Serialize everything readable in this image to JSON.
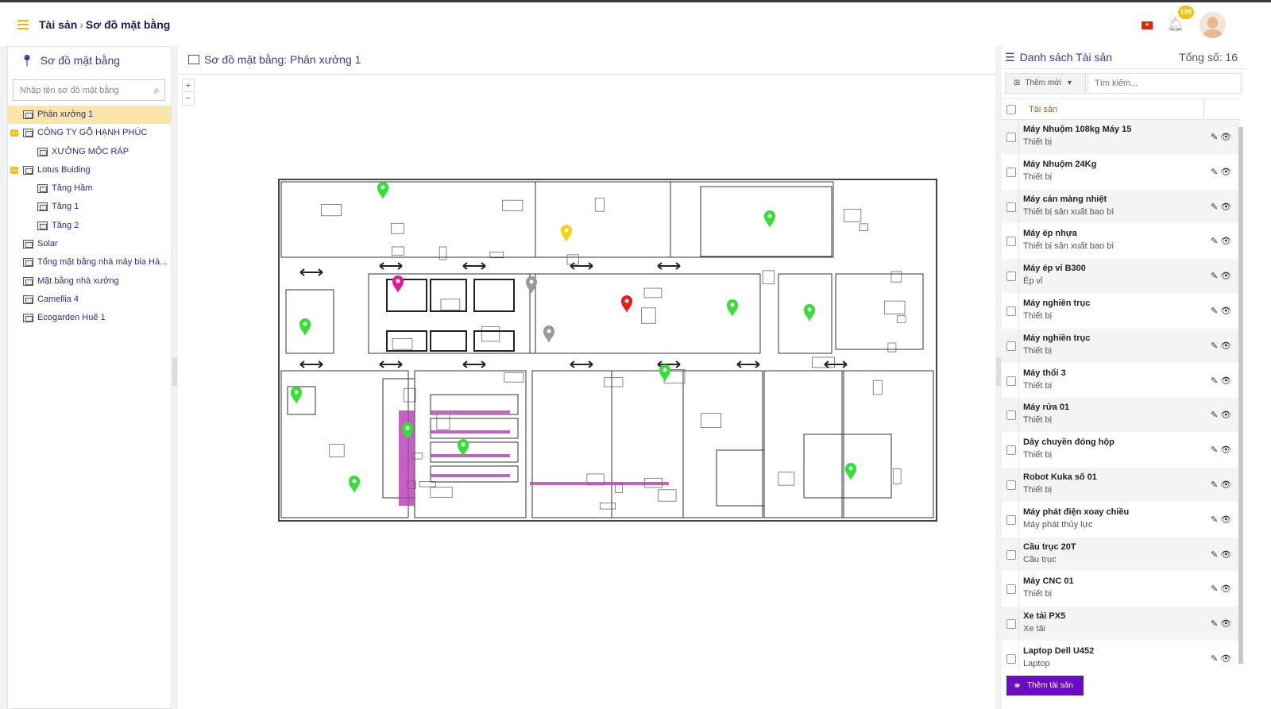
{
  "header": {
    "menu_icon": "hamburger-icon",
    "breadcrumb": [
      "Tài sản",
      "Sơ đồ mặt bằng"
    ],
    "notification_count": "195",
    "language_flag": "vn"
  },
  "left": {
    "title": "Sơ đồ mặt bằng",
    "search_placeholder": "Nhập tên sơ đồ mặt bằng",
    "tree": [
      {
        "label": "Phân xưởng 1",
        "level": 0,
        "selected": true,
        "expandable": false
      },
      {
        "label": "CÔNG TY GỖ HẠNH PHÚC",
        "level": 0,
        "expandable": true
      },
      {
        "label": "XƯỞNG MỘC RÁP",
        "level": 1
      },
      {
        "label": "Lotus Buiding",
        "level": 0,
        "expandable": true
      },
      {
        "label": "Tầng Hầm",
        "level": 1
      },
      {
        "label": "Tầng 1",
        "level": 1
      },
      {
        "label": "Tầng 2",
        "level": 1
      },
      {
        "label": "Solar",
        "level": 0
      },
      {
        "label": "Tổng mặt bằng nhà máy bia Hà...",
        "level": 0
      },
      {
        "label": "Mặt bằng nhà xưởng",
        "level": 0
      },
      {
        "label": "Camellia 4",
        "level": 0
      },
      {
        "label": "Ecogarden Huế 1",
        "level": 0
      }
    ]
  },
  "center": {
    "title": "Sơ đồ mặt bằng: Phân xưởng 1",
    "zoom_in": "+",
    "zoom_out": "−",
    "marker_colors": {
      "green": "#33e033",
      "pink": "#e0199a",
      "yellow": "#f2d40c",
      "red": "#e81c1c",
      "grey": "#9a9a9a"
    }
  },
  "right": {
    "title": "Danh sách Tài sản",
    "total": "Tổng số: 16",
    "add_new": "Thêm mới",
    "search_placeholder": "Tìm kiếm...",
    "column": "Tài sản",
    "add_asset": "Thêm tài sản",
    "accent": "#6a0dc2",
    "items": [
      {
        "name": "Máy Nhuộm 108kg Máy 15",
        "type": "Thiết bị"
      },
      {
        "name": "Máy Nhuộm 24Kg",
        "type": "Thiết bị"
      },
      {
        "name": "Máy cán màng nhiệt",
        "type": "Thiết bị sản xuất bao bì"
      },
      {
        "name": "Máy ép nhựa",
        "type": "Thiết bị sản xuất bao bì"
      },
      {
        "name": "Máy ép vỉ B300",
        "type": "Ép vỉ"
      },
      {
        "name": "Máy nghiền trục",
        "type": "Thiết bị"
      },
      {
        "name": "Máy nghiền trục",
        "type": "Thiết bị"
      },
      {
        "name": "Máy thổi 3",
        "type": "Thiết bị"
      },
      {
        "name": "Máy rửa 01",
        "type": "Thiết bị"
      },
      {
        "name": "Dây chuyền đóng hộp",
        "type": "Thiết bị"
      },
      {
        "name": "Robot Kuka số 01",
        "type": "Thiết bị"
      },
      {
        "name": "Máy phát điện xoay chiều",
        "type": "Máy phát thủy lực"
      },
      {
        "name": "Cầu trục 20T",
        "type": "Cầu trục"
      },
      {
        "name": "Máy CNC 01",
        "type": "Thiết bị"
      },
      {
        "name": "Xe tải PX5",
        "type": "Xe tải"
      },
      {
        "name": "Laptop Dell U452",
        "type": "Laptop"
      }
    ]
  }
}
